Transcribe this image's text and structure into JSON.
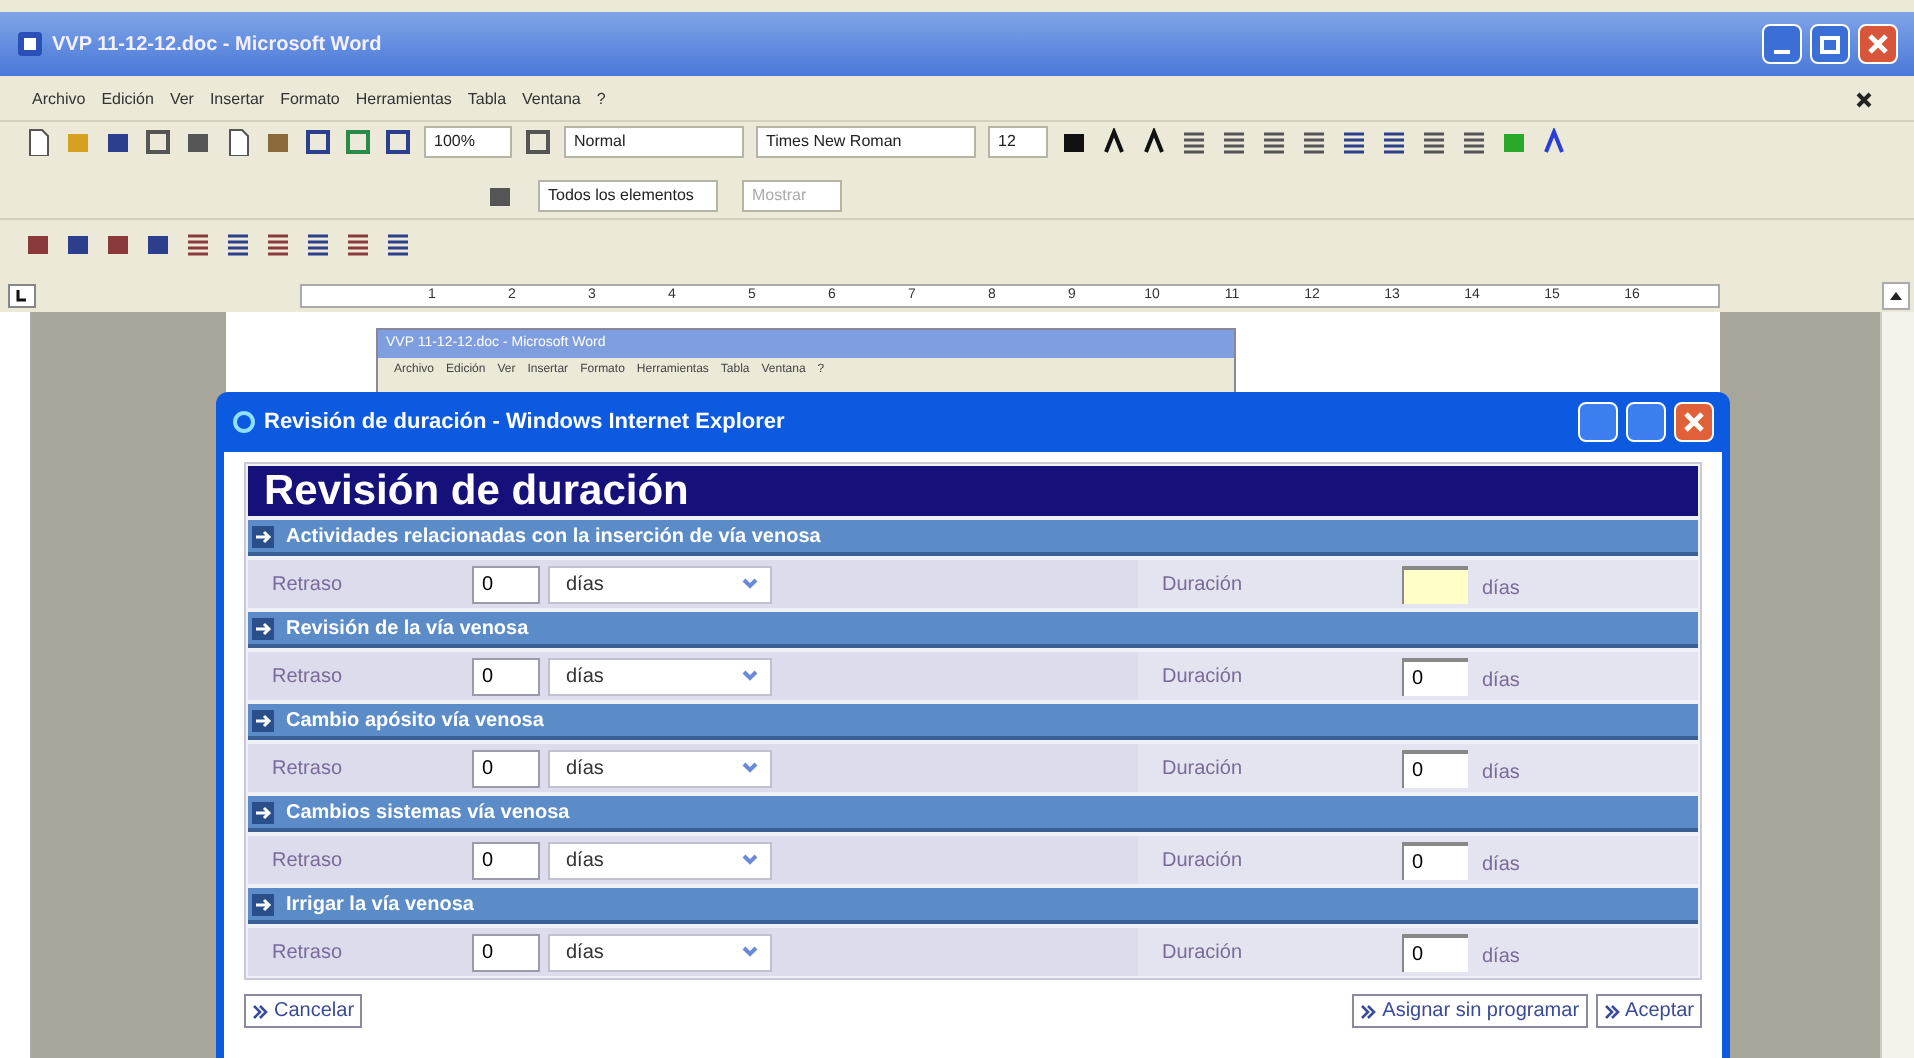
{
  "window": {
    "title": "VVP 11-12-12.doc - Microsoft Word"
  },
  "menu": [
    "Archivo",
    "Edición",
    "Ver",
    "Insertar",
    "Formato",
    "Herramientas",
    "Tabla",
    "Ventana",
    "?"
  ],
  "toolbar": {
    "zoom": "100%",
    "style": "Normal",
    "font": "Times New Roman",
    "size": "12"
  },
  "review_toolbar": {
    "view": "Todos los elementos",
    "show": "Mostrar"
  },
  "ruler": [
    "1",
    "2",
    "3",
    "4",
    "5",
    "6",
    "7",
    "8",
    "9",
    "10",
    "11",
    "12",
    "13",
    "14",
    "15",
    "16"
  ],
  "embedded_screenshot": {
    "title": "VVP 11-12-12.doc - Microsoft Word",
    "menu": [
      "Archivo",
      "Edición",
      "Ver",
      "Insertar",
      "Formato",
      "Herramientas",
      "Tabla",
      "Ventana",
      "?"
    ]
  },
  "dialog": {
    "title": "Revisión de duración - Windows Internet Explorer",
    "heading": "Revisión de duración",
    "sections": [
      {
        "title": "Actividades relacionadas con la inserción de vía venosa",
        "delay_label": "Retraso",
        "delay": "0",
        "delay_unit": "días",
        "duration_label": "Duración",
        "duration_unit": "días",
        "focused": true
      },
      {
        "title": "Revisión de la vía venosa",
        "delay_label": "Retraso",
        "delay": "0",
        "delay_unit": "días",
        "duration_label": "Duración",
        "duration": "0",
        "duration_unit": "días",
        "focused": false
      },
      {
        "title": "Cambio apósito vía venosa",
        "delay_label": "Retraso",
        "delay": "0",
        "delay_unit": "días",
        "duration_label": "Duración",
        "duration": "0",
        "duration_unit": "días",
        "focused": false
      },
      {
        "title": "Cambios sistemas vía venosa",
        "delay_label": "Retraso",
        "delay": "0",
        "delay_unit": "días",
        "duration_label": "Duración",
        "duration": "0",
        "duration_unit": "días",
        "focused": false
      },
      {
        "title": "Irrigar la vía venosa",
        "delay_label": "Retraso",
        "delay": "0",
        "delay_unit": "días",
        "duration_label": "Duración",
        "duration": "0",
        "duration_unit": "días",
        "focused": false
      }
    ],
    "left_buttons": [
      "Cancelar"
    ],
    "right_buttons": [
      "Asignar sin programar",
      "Aceptar"
    ]
  }
}
